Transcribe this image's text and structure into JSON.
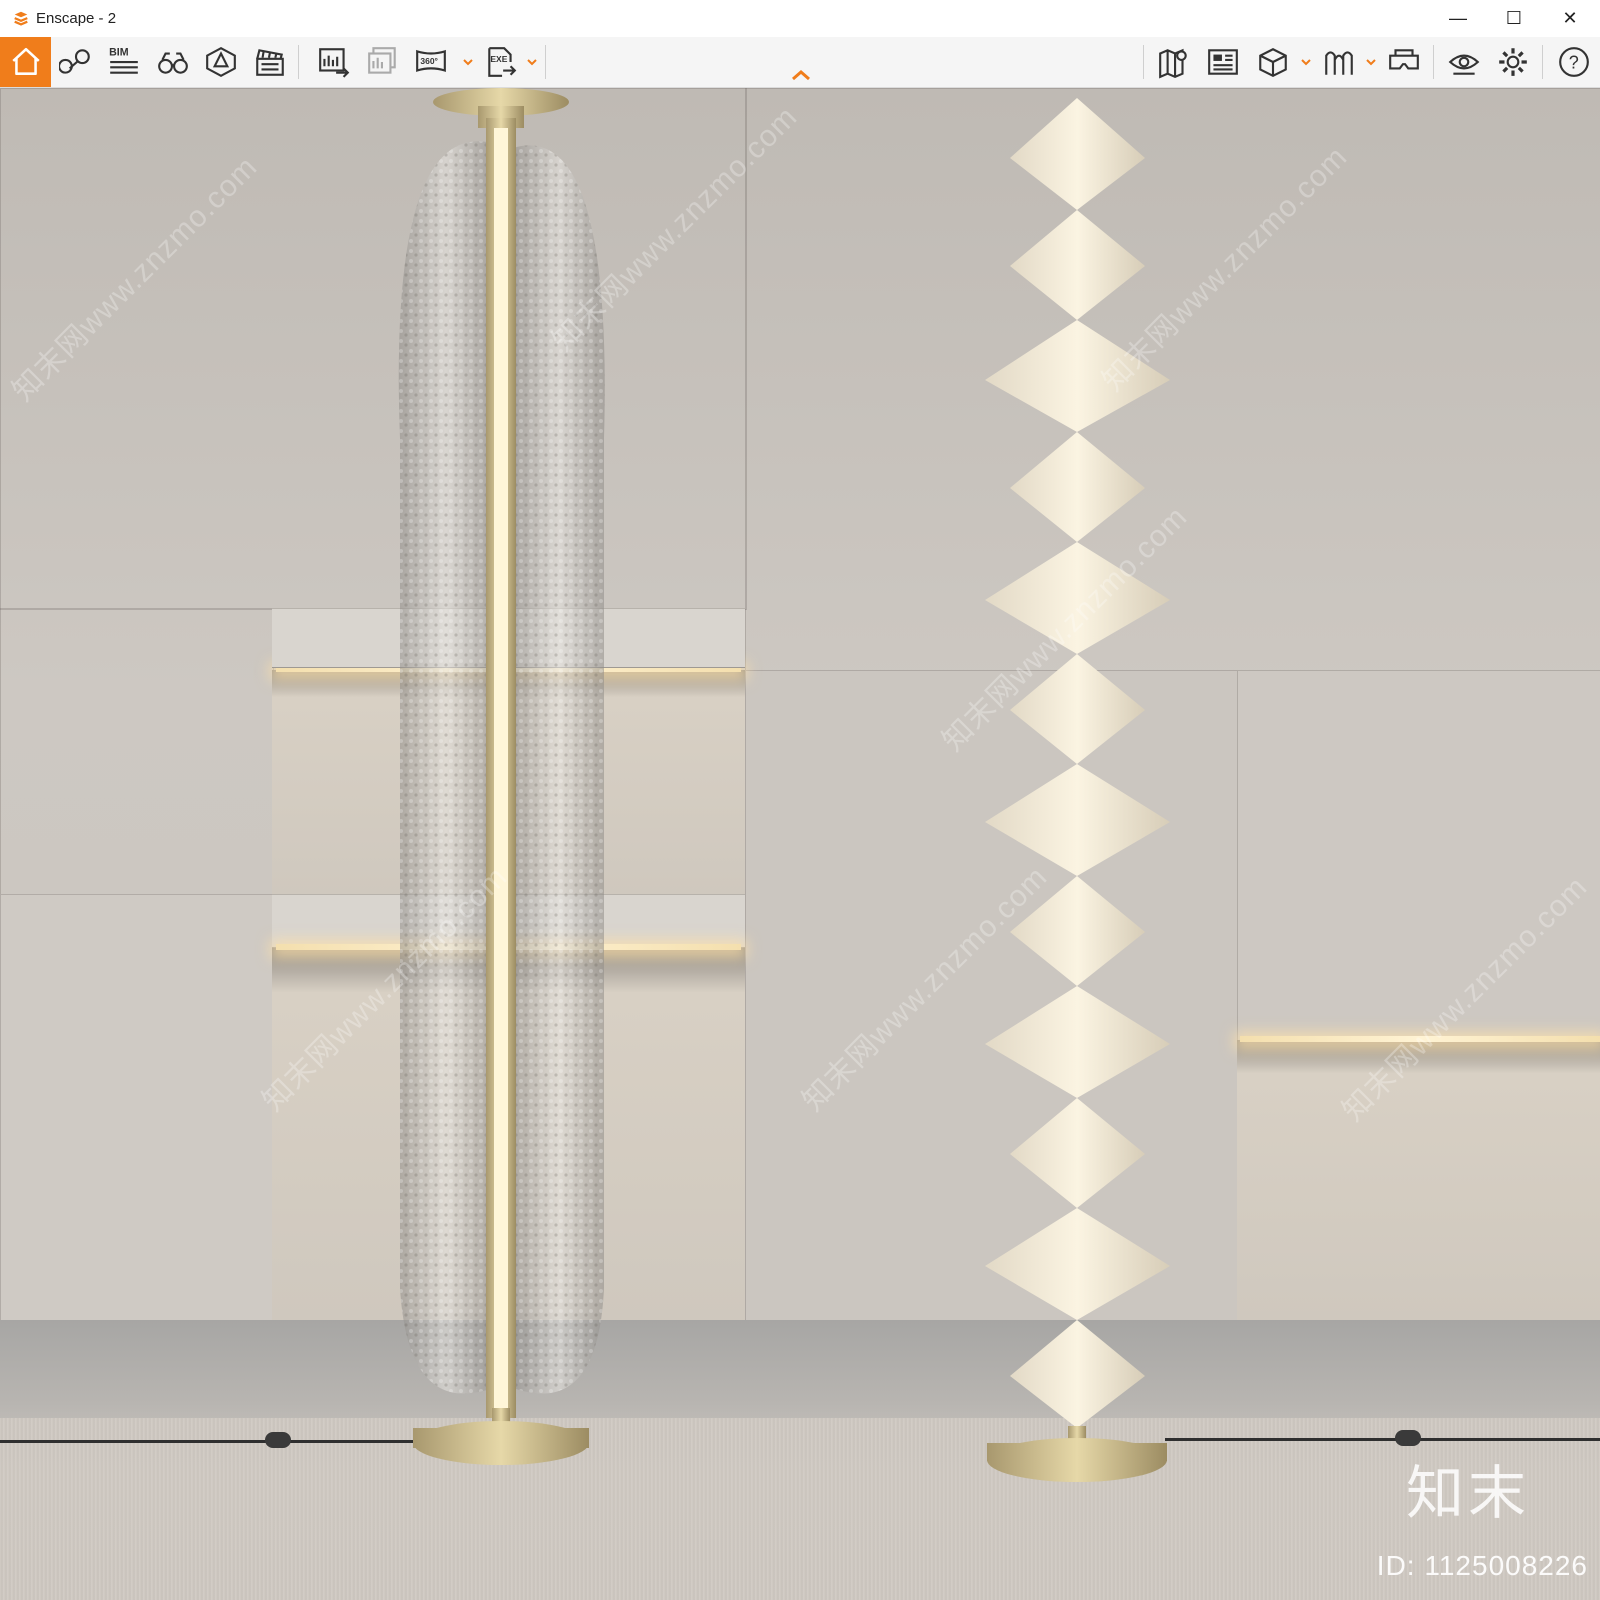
{
  "window": {
    "title": "Enscape - 2",
    "minimize_glyph": "—",
    "maximize_glyph": "☐",
    "close_glyph": "✕"
  },
  "toolbar": {
    "accent_color": "#f07d1b",
    "buttons": [
      {
        "name": "home-icon"
      },
      {
        "name": "map-pin-icon"
      },
      {
        "name": "bim-icon",
        "label": "BIM"
      },
      {
        "name": "binoculars-icon"
      },
      {
        "name": "asset-library-icon"
      },
      {
        "name": "clapperboard-icon"
      },
      {
        "name": "render-export-icon"
      },
      {
        "name": "batch-render-icon"
      },
      {
        "name": "panorama-360-icon",
        "label": "360°"
      },
      {
        "name": "exe-export-icon",
        "label": "EXE"
      },
      {
        "name": "map-icon"
      },
      {
        "name": "views-icon"
      },
      {
        "name": "cube-icon"
      },
      {
        "name": "walk-mode-icon"
      },
      {
        "name": "vr-headset-icon"
      },
      {
        "name": "visual-settings-icon"
      },
      {
        "name": "settings-gear-icon"
      },
      {
        "name": "help-icon",
        "label": "?"
      }
    ]
  },
  "scene": {
    "watermark_text": "知末网www.znzmo.com",
    "brand_mark": "知末",
    "image_id": "ID: 1125008226"
  }
}
